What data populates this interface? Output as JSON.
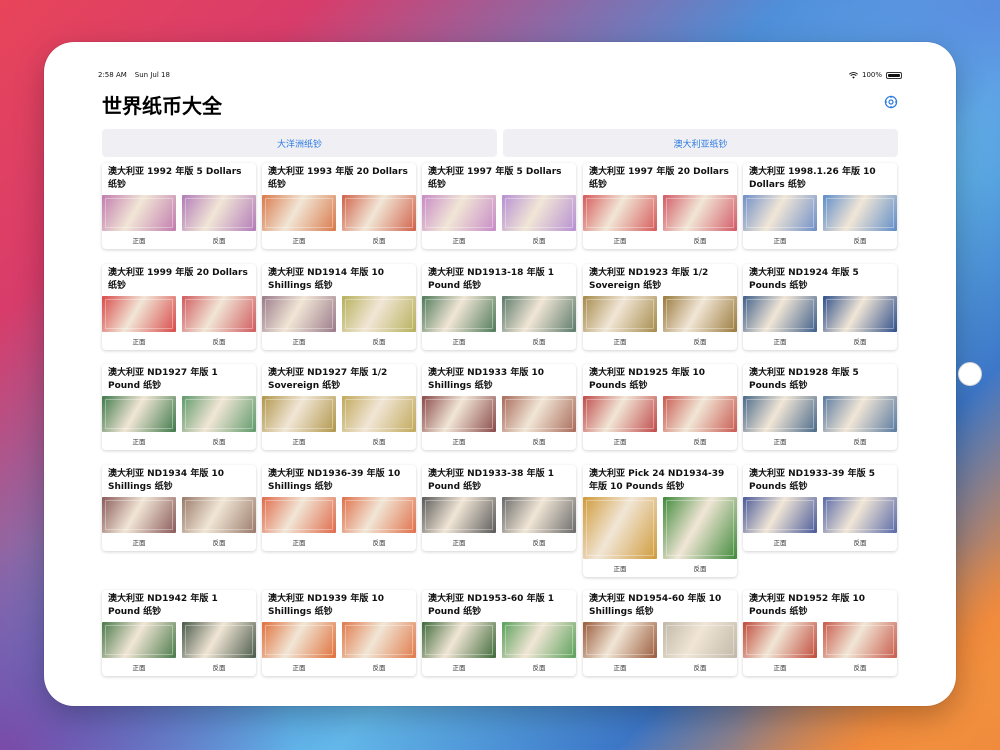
{
  "status": {
    "time": "2:58 AM",
    "date": "Sun Jul 18",
    "battery": "100%",
    "battery_level": 1.0
  },
  "app": {
    "title": "世界纸币大全"
  },
  "tabs": [
    {
      "label": "大洋洲纸钞"
    },
    {
      "label": "澳大利亚纸钞"
    }
  ],
  "labels": {
    "front": "正面",
    "back": "反面"
  },
  "cards": [
    {
      "title": "澳大利亚 1992 年版 5 Dollars 纸钞",
      "front_color": "#c27cae",
      "back_color": "#b27ab8"
    },
    {
      "title": "澳大利亚 1993 年版 20 Dollars 纸钞",
      "front_color": "#d9794a",
      "back_color": "#d0624a"
    },
    {
      "title": "澳大利亚 1997 年版 5 Dollars 纸钞",
      "front_color": "#c78ac6",
      "back_color": "#b68fd2"
    },
    {
      "title": "澳大利亚 1997 年版 20 Dollars 纸钞",
      "front_color": "#d65a5a",
      "back_color": "#d35a66"
    },
    {
      "title": "澳大利亚 1998.1.26 年版 10 Dollars 纸钞",
      "front_color": "#6f8fc8",
      "back_color": "#5f8dc8"
    },
    {
      "title": "澳大利亚 1999 年版 20 Dollars 纸钞",
      "front_color": "#d94a4a",
      "back_color": "#d05a5e"
    },
    {
      "title": "澳大利亚 ND1914 年版 10 Shillings 纸钞",
      "front_color": "#9a7a8a",
      "back_color": "#b6b05a"
    },
    {
      "title": "澳大利亚 ND1913-18 年版 1 Pound 纸钞",
      "front_color": "#4f7a5a",
      "back_color": "#5c7a6a"
    },
    {
      "title": "澳大利亚 ND1923 年版 1/2 Sovereign 纸钞",
      "front_color": "#a58a4a",
      "back_color": "#9a7a3c"
    },
    {
      "title": "澳大利亚 ND1924 年版 5 Pounds 纸钞",
      "front_color": "#3f5f8a",
      "back_color": "#30508a"
    },
    {
      "title": "澳大利亚 ND1927 年版 1 Pound 纸钞",
      "front_color": "#3f7a4a",
      "back_color": "#5f9a6a"
    },
    {
      "title": "澳大利亚 ND1927 年版 1/2 Sovereign 纸钞",
      "front_color": "#b0964a",
      "back_color": "#c0a85a"
    },
    {
      "title": "澳大利亚 ND1933 年版 10 Shillings 纸钞",
      "front_color": "#8a4a4a",
      "back_color": "#a86a5a"
    },
    {
      "title": "澳大利亚 ND1925 年版 10 Pounds 纸钞",
      "front_color": "#c04a4a",
      "back_color": "#c85a50"
    },
    {
      "title": "澳大利亚 ND1928 年版 5 Pounds 纸钞",
      "front_color": "#4a6a8a",
      "back_color": "#5a7aa0"
    },
    {
      "title": "澳大利亚 ND1934 年版 10 Shillings 纸钞",
      "front_color": "#8a5a5a",
      "back_color": "#9a7a6a"
    },
    {
      "title": "澳大利亚 ND1936-39 年版 10 Shillings 纸钞",
      "front_color": "#e06a4a",
      "back_color": "#e0704a"
    },
    {
      "title": "澳大利亚 ND1933-38 年版 1 Pound 纸钞",
      "front_color": "#5a5a5a",
      "back_color": "#6a6a6a"
    },
    {
      "title": "澳大利亚 Pick 24 ND1934-39 年版 10 Pounds 纸钞",
      "front_color": "#d09a3a",
      "back_color": "#3f8a3a"
    },
    {
      "title": "澳大利亚 ND1933-39 年版 5 Pounds 纸钞",
      "front_color": "#4a5a9a",
      "back_color": "#5a6aa8"
    },
    {
      "title": "澳大利亚 ND1942 年版 1 Pound 纸钞",
      "front_color": "#4a7a4a",
      "back_color": "#4a5a4a"
    },
    {
      "title": "澳大利亚 ND1939 年版 10 Shillings 纸钞",
      "front_color": "#e0703a",
      "back_color": "#e07a4a"
    },
    {
      "title": "澳大利亚 ND1953-60 年版 1 Pound 纸钞",
      "front_color": "#3f6a3a",
      "back_color": "#5aa05a"
    },
    {
      "title": "澳大利亚 ND1954-60 年版 10 Shillings 纸钞",
      "front_color": "#9a5a3a",
      "back_color": "#c0b8a8"
    },
    {
      "title": "澳大利亚 ND1952 年版 10 Pounds 纸钞",
      "front_color": "#c04a3a",
      "back_color": "#c85a4a"
    }
  ]
}
